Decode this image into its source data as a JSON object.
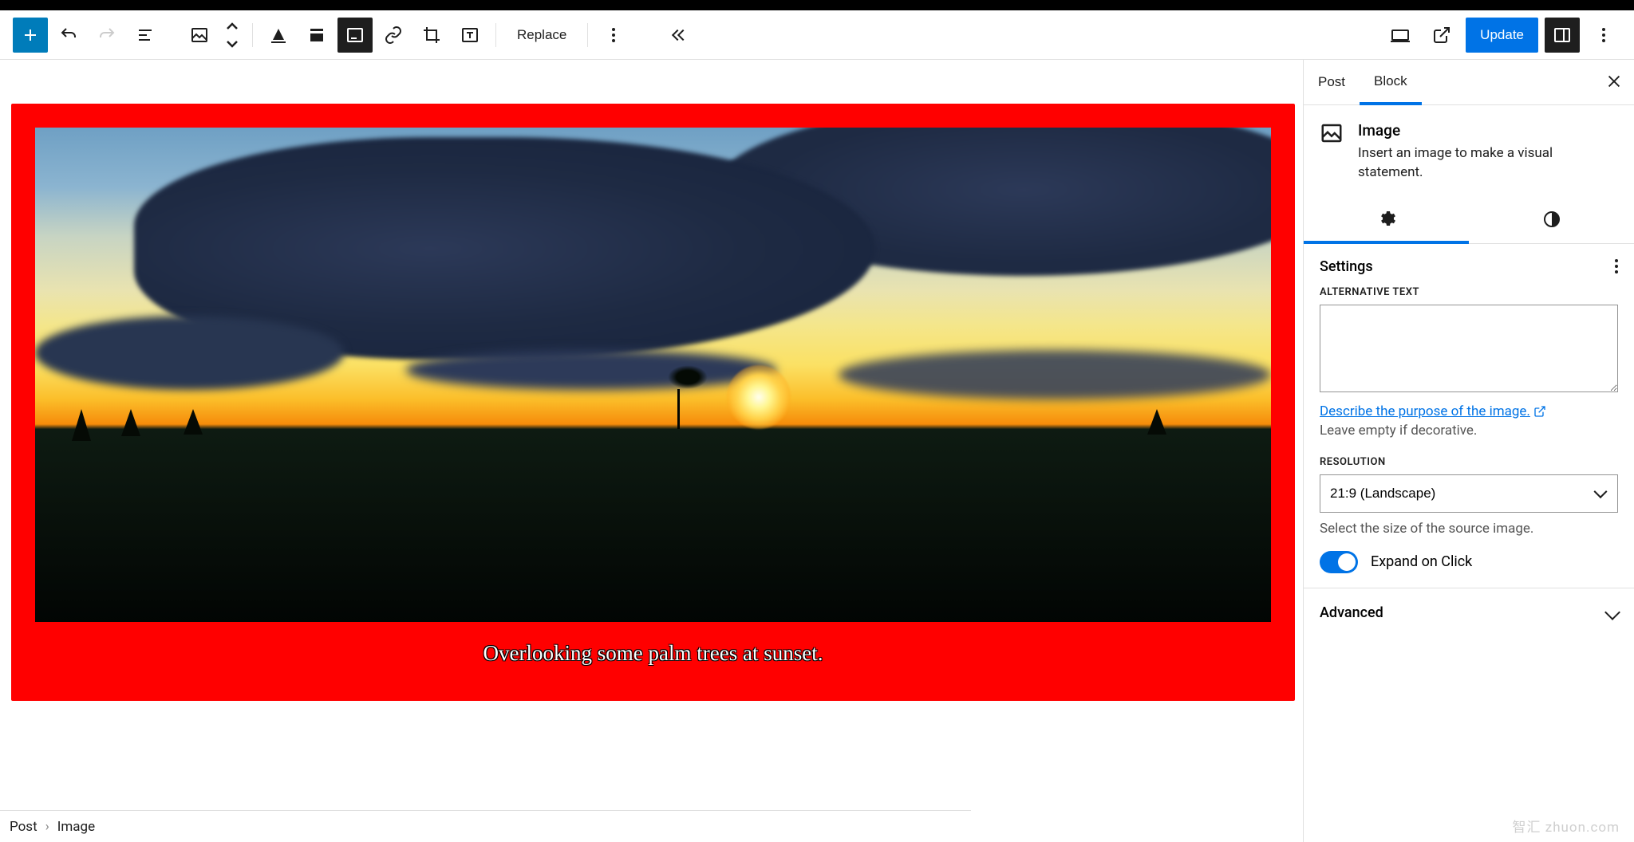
{
  "toolbar": {
    "replace_label": "Replace",
    "update_label": "Update"
  },
  "sidebar": {
    "tabs": {
      "post": "Post",
      "block": "Block"
    },
    "block": {
      "title": "Image",
      "desc": "Insert an image to make a visual statement."
    },
    "settings": {
      "heading": "Settings",
      "alt_label": "Alternative Text",
      "alt_value": "",
      "alt_link": "Describe the purpose of the image.",
      "alt_hint": "Leave empty if decorative.",
      "resolution_label": "Resolution",
      "resolution_value": "21:9 (Landscape)",
      "resolution_hint": "Select the size of the source image.",
      "expand_label": "Expand on Click"
    },
    "advanced": "Advanced"
  },
  "canvas": {
    "caption": "Overlooking some palm trees at sunset."
  },
  "breadcrumb": {
    "root": "Post",
    "leaf": "Image"
  },
  "watermark": "智汇 zhuon.com"
}
